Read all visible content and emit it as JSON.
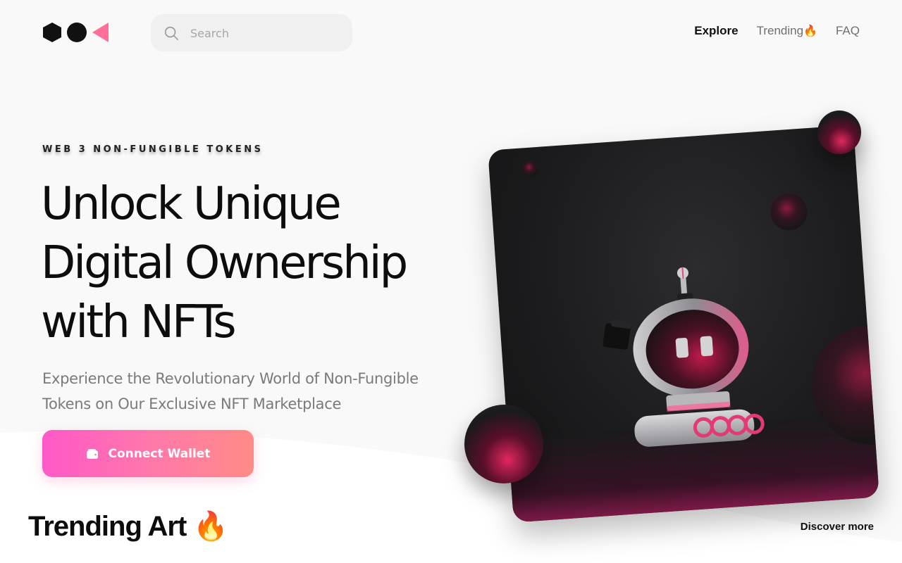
{
  "header": {
    "search": {
      "placeholder": "Search",
      "value": ""
    },
    "nav": [
      {
        "label": "Explore",
        "active": true
      },
      {
        "label": "Trending",
        "emoji": "🔥",
        "active": false
      },
      {
        "label": "FAQ",
        "active": false
      }
    ]
  },
  "hero": {
    "eyebrow": "WEB 3 NON-FUNGIBLE TOKENS",
    "title_lines": [
      "Unlock Unique",
      "Digital Ownership",
      "with NFTs"
    ],
    "subtitle_lines": [
      "Experience the Revolutionary World of Non-Fungible",
      "Tokens on Our Exclusive NFT Marketplace"
    ],
    "cta_label": "Connect Wallet"
  },
  "trending": {
    "title": "Trending Art",
    "emoji": "🔥",
    "discover_label": "Discover more"
  },
  "colors": {
    "accent_pink": "#ff58c8",
    "accent_coral": "#ff8b86",
    "logo_triangle": "#ff6f9a",
    "text_dark": "#0d0d0d",
    "text_muted": "#7a7a7a"
  },
  "icons": {
    "logo": "hexagon-circle-triangle-logo",
    "search": "search-icon",
    "wallet": "wallet-icon",
    "fire": "fire-emoji"
  }
}
